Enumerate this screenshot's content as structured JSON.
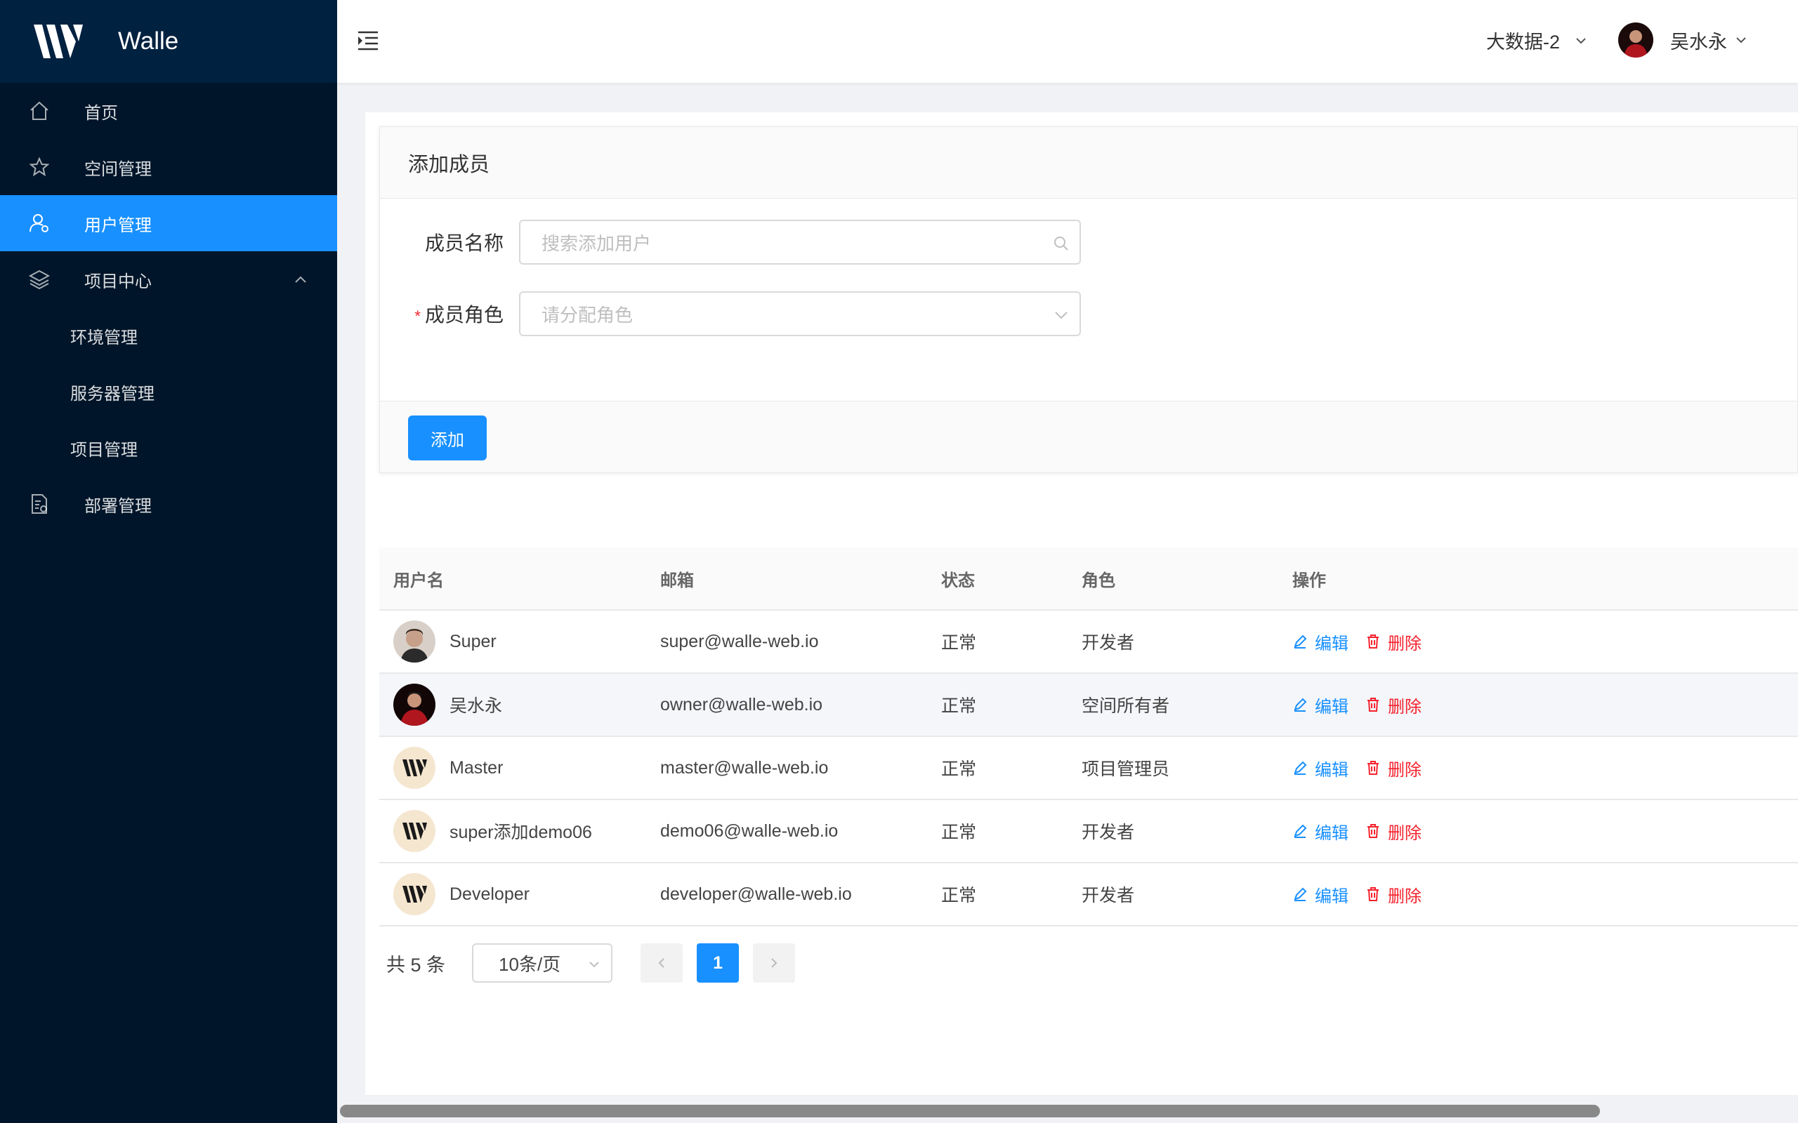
{
  "app": {
    "name": "Walle"
  },
  "sidebar": {
    "items": [
      {
        "label": "首页",
        "icon": "home-icon"
      },
      {
        "label": "空间管理",
        "icon": "star-icon"
      },
      {
        "label": "用户管理",
        "icon": "user-icon",
        "active": true
      },
      {
        "label": "项目中心",
        "icon": "layers-icon",
        "expanded": true
      },
      {
        "label": "部署管理",
        "icon": "deploy-doc-icon"
      }
    ],
    "submenu": [
      {
        "label": "环境管理"
      },
      {
        "label": "服务器管理"
      },
      {
        "label": "项目管理"
      }
    ]
  },
  "header": {
    "space": "大数据-2",
    "user": "吴水永"
  },
  "add_member": {
    "title": "添加成员",
    "name_label": "成员名称",
    "name_placeholder": "搜索添加用户",
    "role_label": "成员角色",
    "role_placeholder": "请分配角色",
    "submit": "添加"
  },
  "table": {
    "columns": [
      "用户名",
      "邮箱",
      "状态",
      "角色",
      "操作"
    ],
    "rows": [
      {
        "name": "Super",
        "email": "super@walle-web.io",
        "status": "正常",
        "role": "开发者",
        "avatar": "photo-super"
      },
      {
        "name": "吴水永",
        "email": "owner@walle-web.io",
        "status": "正常",
        "role": "空间所有者",
        "avatar": "photo-owner"
      },
      {
        "name": "Master",
        "email": "master@walle-web.io",
        "status": "正常",
        "role": "项目管理员",
        "avatar": "walle-logo"
      },
      {
        "name": "super添加demo06",
        "email": "demo06@walle-web.io",
        "status": "正常",
        "role": "开发者",
        "avatar": "walle-logo"
      },
      {
        "name": "Developer",
        "email": "developer@walle-web.io",
        "status": "正常",
        "role": "开发者",
        "avatar": "walle-logo"
      }
    ],
    "edit_label": "编辑",
    "delete_label": "删除"
  },
  "pagination": {
    "total": "共 5 条",
    "page_size": "10条/页",
    "current": "1"
  },
  "colors": {
    "primary": "#1890ff",
    "sidebar": "#001529",
    "danger": "#f5222d"
  }
}
